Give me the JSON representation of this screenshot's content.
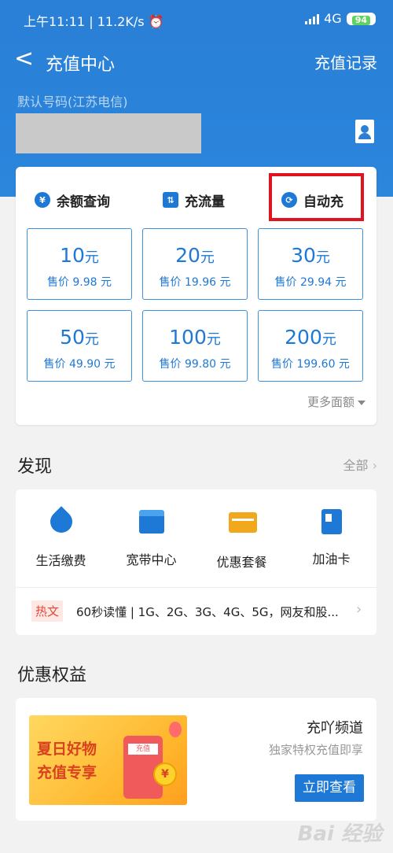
{
  "status": {
    "time": "上午11:11",
    "speed": "11.2K/s",
    "network": "4G",
    "battery": "94"
  },
  "nav": {
    "back": "<",
    "title": "充值中心",
    "record": "充值记录"
  },
  "phone": {
    "label": "默认号码(江苏电信)"
  },
  "quick_tabs": [
    {
      "label": "余额查询",
      "icon": "yen-icon",
      "glyph": "¥"
    },
    {
      "label": "充流量",
      "icon": "traffic-icon",
      "glyph": "⇅"
    },
    {
      "label": "自动充",
      "icon": "refresh-icon",
      "glyph": "⟳"
    }
  ],
  "amounts": [
    {
      "value": "10",
      "unit": "元",
      "price": "售价 9.98 元"
    },
    {
      "value": "20",
      "unit": "元",
      "price": "售价 19.96 元"
    },
    {
      "value": "30",
      "unit": "元",
      "price": "售价 29.94 元"
    },
    {
      "value": "50",
      "unit": "元",
      "price": "售价 49.90 元"
    },
    {
      "value": "100",
      "unit": "元",
      "price": "售价 99.80 元"
    },
    {
      "value": "200",
      "unit": "元",
      "price": "售价 199.60 元"
    }
  ],
  "more_amounts": "更多面额",
  "discover": {
    "title": "发现",
    "all": "全部",
    "items": [
      {
        "label": "生活缴费",
        "icon": "drop-icon"
      },
      {
        "label": "宽带中心",
        "icon": "shop-icon"
      },
      {
        "label": "优惠套餐",
        "icon": "coupon-icon"
      },
      {
        "label": "加油卡",
        "icon": "fuel-card-icon"
      }
    ],
    "hot_tag": "热文",
    "hot_text": "60秒读懂 | 1G、2G、3G、4G、5G，网友和股..."
  },
  "benefits": {
    "title": "优惠权益",
    "banner_line1": "夏日好物",
    "banner_line2": "充值专享",
    "banner_phone_text": "充值",
    "banner_coin": "¥",
    "promo_title": "充吖频道",
    "promo_sub": "独家特权充值即享",
    "promo_button": "立即查看"
  },
  "watermark": "Bai 经验",
  "colors": {
    "primary": "#1e78d6",
    "header": "#2a7fd6",
    "highlight": "#e0141e"
  }
}
